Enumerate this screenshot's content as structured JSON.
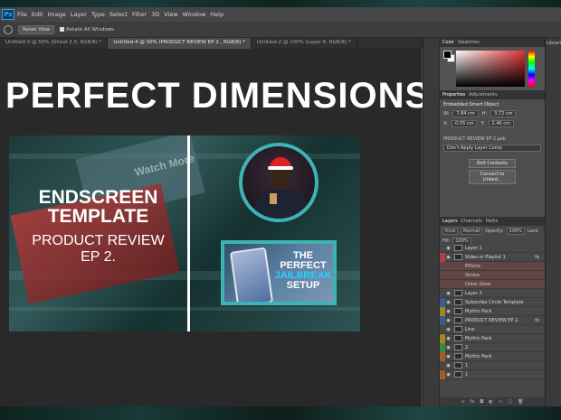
{
  "menu": {
    "items": [
      "File",
      "Edit",
      "Image",
      "Layer",
      "Type",
      "Select",
      "Filter",
      "3D",
      "View",
      "Window",
      "Help"
    ]
  },
  "options_bar": {
    "reset_label": "Reset View",
    "rotate_label": "Rotate All Windows"
  },
  "tabs": [
    {
      "label": "Untitled-3 @ 50% (Ghost 2.0, RGB/8) *",
      "active": false
    },
    {
      "label": "Untitled-4 @ 50% (PRODUCT REVIEW EP 2., RGB/8) *",
      "active": true
    },
    {
      "label": "Untitled-2 @ 100% (Layer 6, RGB/8) *",
      "active": false
    }
  ],
  "canvas": {
    "headline": "PERFECT DIMENSIONS",
    "endscreen_title_1": "ENDSCREEN",
    "endscreen_title_2": "TEMPLATE",
    "endscreen_sub_1": "PRODUCT REVIEW",
    "endscreen_sub_2": "EP 2.",
    "watch_more": "Watch More",
    "video_line_1": "THE",
    "video_line_2": "PERFECT",
    "video_line_3": "JAILBREAK",
    "video_line_4": "SETUP"
  },
  "color_panel": {
    "tab_active": "Color",
    "tab_other": "Swatches"
  },
  "properties": {
    "tab_active": "Properties",
    "tab_other": "Adjustments",
    "type": "Embedded Smart Object",
    "w_label": "W:",
    "w_value": "7.84 cm",
    "h_label": "H:",
    "h_value": "3.72 cm",
    "x_label": "X:",
    "x_value": "0.05 cm",
    "y_label": "Y:",
    "y_value": "2.46 cm",
    "file": "PRODUCT REVIEW EP 2.psb",
    "comp": "Don't Apply Layer Comp",
    "edit_btn": "Edit Contents",
    "convert_btn": "Convert to Linked..."
  },
  "layers_panel": {
    "tabs": [
      "Layers",
      "Channels",
      "Paths"
    ],
    "kind": "Kind",
    "blend": "Normal",
    "opacity_label": "Opacity:",
    "opacity": "100%",
    "lock_label": "Lock:",
    "fill_label": "Fill:",
    "fill": "100%",
    "layers": [
      {
        "name": "Layer 1",
        "color": "",
        "fx": false,
        "sub": false
      },
      {
        "name": "Video or Playlist 1",
        "color": "#b04040",
        "fx": true,
        "sub": false
      },
      {
        "name": "Effects",
        "color": "#b04040",
        "fx": false,
        "sub": true
      },
      {
        "name": "Stroke",
        "color": "#b04040",
        "fx": false,
        "sub": true
      },
      {
        "name": "Outer Glow",
        "color": "#b04040",
        "fx": false,
        "sub": true
      },
      {
        "name": "Layer 2",
        "color": "",
        "fx": false,
        "sub": false
      },
      {
        "name": "Subscribe Circle Template",
        "color": "#3a5a90",
        "fx": false,
        "sub": false
      },
      {
        "name": "Mythic Pack",
        "color": "#a08a20",
        "fx": false,
        "sub": false
      },
      {
        "name": "PRODUCT REVIEW EP 2.",
        "color": "#3a5a90",
        "fx": true,
        "sub": false
      },
      {
        "name": "Line",
        "color": "",
        "fx": false,
        "sub": false
      },
      {
        "name": "Mythic Pack",
        "color": "#a08a20",
        "fx": false,
        "sub": false
      },
      {
        "name": "2",
        "color": "#3a8a40",
        "fx": false,
        "sub": false
      },
      {
        "name": "Mythic Pack",
        "color": "#a06020",
        "fx": false,
        "sub": false
      },
      {
        "name": "1",
        "color": "",
        "fx": false,
        "sub": false
      },
      {
        "name": "1",
        "color": "#a06020",
        "fx": false,
        "sub": false
      }
    ]
  },
  "right_panel": {
    "label": "Libraries"
  }
}
